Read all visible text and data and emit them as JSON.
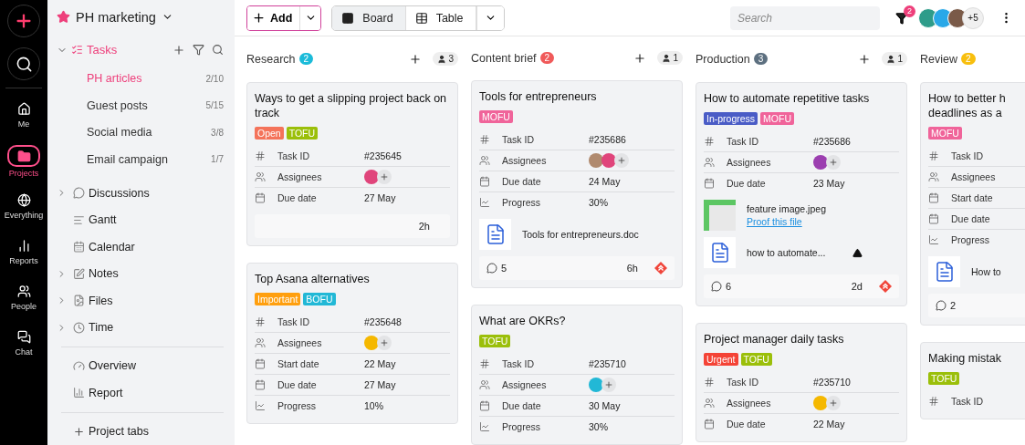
{
  "rail": {
    "actions": [
      {
        "kind": "create"
      },
      {
        "kind": "search"
      }
    ],
    "items": [
      {
        "kind": "me",
        "label": "Me",
        "selected": false
      },
      {
        "kind": "projects",
        "label": "Projects",
        "selected": true
      },
      {
        "kind": "everything",
        "label": "Everything",
        "selected": false
      },
      {
        "kind": "reports",
        "label": "Reports",
        "selected": false
      },
      {
        "kind": "people",
        "label": "People",
        "selected": false
      },
      {
        "kind": "chat",
        "label": "Chat",
        "selected": false
      }
    ]
  },
  "sidebar": {
    "project": {
      "name": "PH marketing",
      "starred": true
    },
    "tasks": {
      "label": "Tasks",
      "expanded": true,
      "lists": [
        {
          "name": "PH articles",
          "count": "2/10",
          "selected": true
        },
        {
          "name": "Guest posts",
          "count": "5/15",
          "selected": false
        },
        {
          "name": "Social media",
          "count": "3/8",
          "selected": false
        },
        {
          "name": "Email campaign",
          "count": "1/7",
          "selected": false
        }
      ]
    },
    "nav": [
      {
        "kind": "discussions",
        "label": "Discussions",
        "expandable": true
      },
      {
        "kind": "gantt",
        "label": "Gantt",
        "expandable": false
      },
      {
        "kind": "calendar",
        "label": "Calendar",
        "expandable": false
      },
      {
        "kind": "notes",
        "label": "Notes",
        "expandable": true
      },
      {
        "kind": "files",
        "label": "Files",
        "expandable": true
      },
      {
        "kind": "time",
        "label": "Time",
        "expandable": true
      }
    ],
    "reports": [
      {
        "kind": "overview",
        "label": "Overview"
      },
      {
        "kind": "report",
        "label": "Report"
      }
    ],
    "add_label": "Project tabs"
  },
  "toolbar": {
    "add_label": "Add",
    "views": [
      {
        "kind": "board",
        "label": "Board",
        "selected": true
      },
      {
        "kind": "table",
        "label": "Table",
        "selected": false
      }
    ],
    "search_placeholder": "Search",
    "filter_count": "2",
    "members": [
      {
        "color": "#2e9c8a"
      },
      {
        "color": "#29a8e8"
      },
      {
        "color": "#7a5a48"
      }
    ],
    "members_more": "+5"
  },
  "columns": [
    {
      "title": "Research",
      "count": "2",
      "color": "#1bbbd9",
      "watchers": "3",
      "cards": [
        {
          "title": "Ways to get a slipping project back on track",
          "tags": [
            {
              "label": "Open",
              "color": "#f4735a"
            },
            {
              "label": "TOFU",
              "color": "#9bbf0a"
            }
          ],
          "fields": [
            {
              "kind": "id",
              "label": "Task ID",
              "value": "#235645"
            },
            {
              "kind": "assignees",
              "label": "Assignees",
              "avatars": [
                {
                  "color": "#e0457b"
                }
              ]
            },
            {
              "kind": "date",
              "label": "Due date",
              "value": "27 May"
            }
          ],
          "footer": {
            "time": "2h"
          }
        },
        {
          "title": "Top Asana alternatives",
          "tags": [
            {
              "label": "Important",
              "color": "#ff9f0e"
            },
            {
              "label": "BOFU",
              "color": "#22b8d6"
            }
          ],
          "fields": [
            {
              "kind": "id",
              "label": "Task ID",
              "value": "#235648"
            },
            {
              "kind": "assignees",
              "label": "Assignees",
              "avatars": [
                {
                  "color": "#f5b800"
                }
              ]
            },
            {
              "kind": "date",
              "label": "Start date",
              "value": "22 May"
            },
            {
              "kind": "date",
              "label": "Due date",
              "value": "27 May"
            },
            {
              "kind": "progress",
              "label": "Progress",
              "value": "10%"
            }
          ]
        }
      ]
    },
    {
      "title": "Content brief",
      "count": "2",
      "color": "#f05a5a",
      "watchers": "1",
      "cards": [
        {
          "title": "Tools for entrepreneurs",
          "tags": [
            {
              "label": "MOFU",
              "color": "#f0649a"
            }
          ],
          "fields": [
            {
              "kind": "id",
              "label": "Task ID",
              "value": "#235686"
            },
            {
              "kind": "assignees",
              "label": "Assignees",
              "avatars": [
                {
                  "color": "#b08a6e"
                },
                {
                  "color": "#e0457b"
                }
              ]
            },
            {
              "kind": "date",
              "label": "Due date",
              "value": "24 May"
            },
            {
              "kind": "progress",
              "label": "Progress",
              "value": "30%"
            }
          ],
          "attachments": [
            {
              "kind": "doc",
              "name": "Tools for entrepreneurs.doc"
            }
          ],
          "footer": {
            "comments": "5",
            "time": "6h",
            "priority": true
          }
        },
        {
          "title": "What are OKRs?",
          "tags": [
            {
              "label": "TOFU",
              "color": "#9bbf0a"
            }
          ],
          "fields": [
            {
              "kind": "id",
              "label": "Task ID",
              "value": "#235710"
            },
            {
              "kind": "assignees",
              "label": "Assignees",
              "avatars": [
                {
                  "color": "#22b8d6"
                }
              ]
            },
            {
              "kind": "date",
              "label": "Due date",
              "value": "30 May"
            },
            {
              "kind": "progress",
              "label": "Progress",
              "value": "30%"
            }
          ]
        }
      ]
    },
    {
      "title": "Production",
      "count": "3",
      "color": "#5d7080",
      "watchers": "1",
      "cards": [
        {
          "title": "How to automate repetitive tasks",
          "tags": [
            {
              "label": "In-progress",
              "color": "#4a5cc6"
            },
            {
              "label": "MOFU",
              "color": "#f0649a"
            }
          ],
          "fields": [
            {
              "kind": "id",
              "label": "Task ID",
              "value": "#235686"
            },
            {
              "kind": "assignees",
              "label": "Assignees",
              "avatars": [
                {
                  "color": "#9c3fb0"
                }
              ]
            },
            {
              "kind": "date",
              "label": "Due date",
              "value": "23 May"
            }
          ],
          "attachments": [
            {
              "kind": "image",
              "name": "feature image.jpeg",
              "link": "Proof this file"
            },
            {
              "kind": "doc",
              "name": "how to automate...",
              "drive": true
            }
          ],
          "footer": {
            "comments": "6",
            "time": "2d",
            "priority": true
          }
        },
        {
          "title": "Project manager daily tasks",
          "tags": [
            {
              "label": "Urgent",
              "color": "#f44336"
            },
            {
              "label": "TOFU",
              "color": "#9bbf0a"
            }
          ],
          "fields": [
            {
              "kind": "id",
              "label": "Task ID",
              "value": "#235710"
            },
            {
              "kind": "assignees",
              "label": "Assignees",
              "avatars": [
                {
                  "color": "#f5b800"
                }
              ]
            },
            {
              "kind": "date",
              "label": "Due date",
              "value": "22 May"
            }
          ]
        }
      ]
    },
    {
      "title": "Review",
      "count": "2",
      "color": "#f8bf0e",
      "cards": [
        {
          "title": "How to better h\ndeadlines as a",
          "tags": [
            {
              "label": "MOFU",
              "color": "#f0649a"
            }
          ],
          "fields": [
            {
              "kind": "id",
              "label": "Task ID"
            },
            {
              "kind": "assignees",
              "label": "Assignees"
            },
            {
              "kind": "date",
              "label": "Start date"
            },
            {
              "kind": "date",
              "label": "Due date"
            },
            {
              "kind": "progress",
              "label": "Progress"
            }
          ],
          "attachments": [
            {
              "kind": "doc",
              "name": "How to"
            }
          ],
          "footer": {
            "comments": "2"
          }
        },
        {
          "title": "Making mistak",
          "tags": [
            {
              "label": "TOFU",
              "color": "#9bbf0a"
            }
          ],
          "fields": [
            {
              "kind": "id",
              "label": "Task ID"
            }
          ]
        }
      ]
    }
  ]
}
